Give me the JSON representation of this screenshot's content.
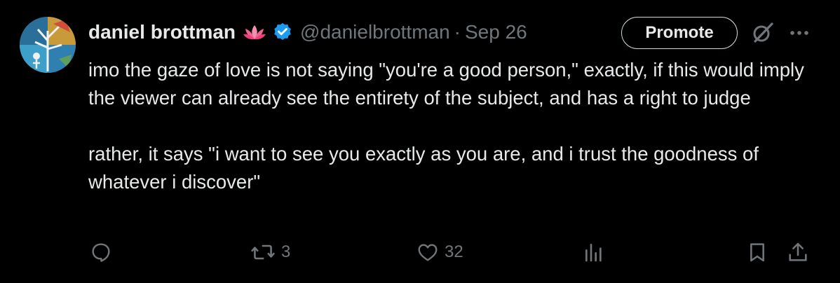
{
  "user": {
    "name": "daniel brottman",
    "handle": "@danielbrottman",
    "separator": "·",
    "date": "Sep 26",
    "emoji_icon": "lotus-icon",
    "verified_icon": "verified-badge-icon"
  },
  "header_actions": {
    "promote_label": "Promote",
    "grok_icon": "grok-icon",
    "more_icon": "more-icon"
  },
  "tweet": {
    "text": "imo the gaze of love is not saying \"you're a good person,\" exactly, if this would imply the viewer can already see the entirety of the subject, and has a right to judge\n\nrather, it says \"i want to see you exactly as you are, and i trust the goodness of whatever i discover\""
  },
  "actions": {
    "reply": {
      "icon": "reply-icon",
      "count": ""
    },
    "retweet": {
      "icon": "retweet-icon",
      "count": "3"
    },
    "like": {
      "icon": "heart-icon",
      "count": "32"
    },
    "views": {
      "icon": "views-icon",
      "count": ""
    },
    "bookmark": {
      "icon": "bookmark-icon"
    },
    "share": {
      "icon": "share-icon"
    }
  },
  "colors": {
    "background": "#000000",
    "text": "#e7e9ea",
    "muted": "#71767b",
    "verified": "#1d9bf0"
  }
}
